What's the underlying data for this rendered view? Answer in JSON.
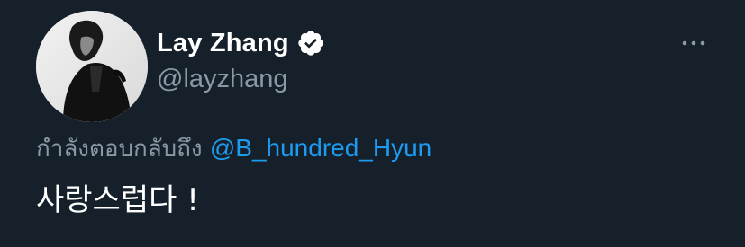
{
  "tweet": {
    "author": {
      "display_name": "Lay Zhang",
      "handle": "@layzhang",
      "verified": true
    },
    "reply_to": {
      "prefix": "กำลังตอบกลับถึง",
      "mention": "@B_hundred_Hyun"
    },
    "text": "사랑스럽다 !"
  },
  "icons": {
    "verified": "verified-badge-icon",
    "more": "more-dots-icon",
    "avatar": "profile-photo"
  },
  "colors": {
    "background": "#15202b",
    "primary_text": "#ffffff",
    "secondary_text": "#8b98a5",
    "link": "#1d9bf0"
  }
}
